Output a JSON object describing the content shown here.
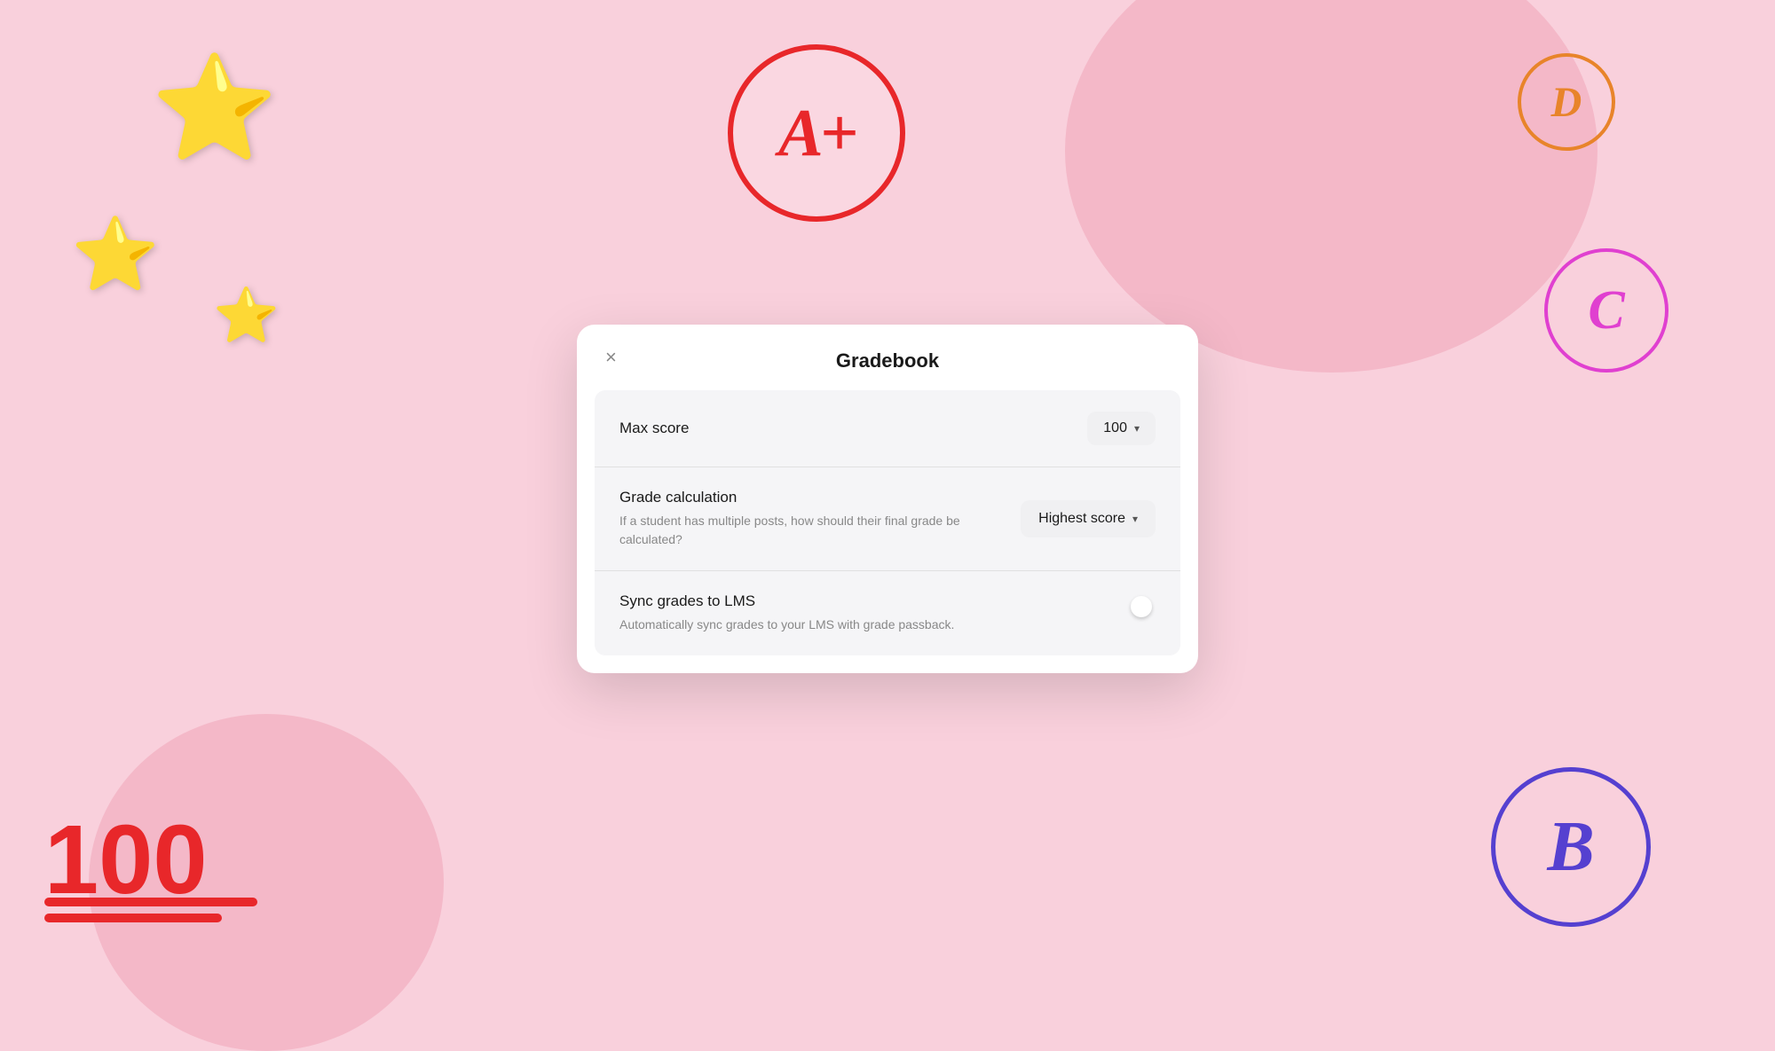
{
  "background": {
    "color": "#f9d0dc"
  },
  "decorations": {
    "stars": [
      "⭐",
      "⭐",
      "⭐"
    ],
    "grade_a_plus": "A+",
    "grade_d": "D",
    "grade_c": "C",
    "grade_b": "B",
    "score_100": "100"
  },
  "modal": {
    "title": "Gradebook",
    "close_label": "×",
    "settings": [
      {
        "id": "max_score",
        "label": "Max score",
        "value": "100",
        "type": "dropdown"
      },
      {
        "id": "grade_calculation",
        "label": "Grade calculation",
        "description": "If a student has multiple posts, how should their final grade be calculated?",
        "value": "Highest score",
        "type": "dropdown"
      },
      {
        "id": "sync_grades",
        "label": "Sync grades to LMS",
        "description": "Automatically sync grades to your LMS with grade passback.",
        "value": true,
        "type": "toggle"
      }
    ],
    "dropdown_chevron": "▾"
  }
}
